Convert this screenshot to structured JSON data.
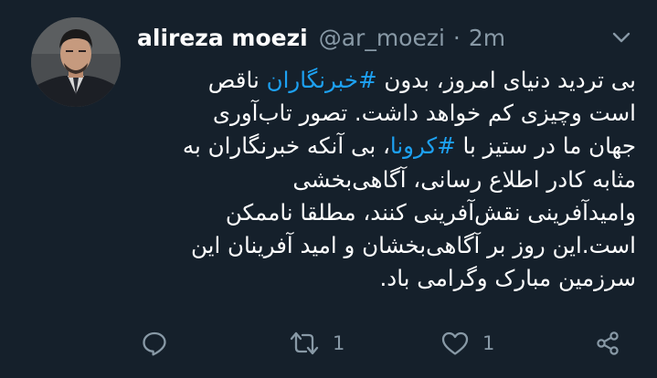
{
  "author": {
    "display_name": "alireza moezi",
    "handle": "@ar_moezi",
    "separator": "·",
    "time": "2m"
  },
  "icons": {
    "avatar": "profile-photo",
    "more": "chevron-down-icon",
    "reply": "reply-icon",
    "retweet": "retweet-icon",
    "like": "heart-icon",
    "share": "share-icon"
  },
  "tweet": {
    "lines": [
      [
        {
          "text": "بی تردید دنیای امروز، بدون ",
          "tag": false
        },
        {
          "text": "#خبرنگاران",
          "tag": true
        },
        {
          "text": " ناقص",
          "tag": false
        }
      ],
      [
        {
          "text": "است وچیزی کم خواهد داشت. تصور تاب‌آوری",
          "tag": false
        }
      ],
      [
        {
          "text": "جهان ما در ستیز با ",
          "tag": false
        },
        {
          "text": "#کرونا",
          "tag": true
        },
        {
          "text": "، بی آنکه خبرنگاران به",
          "tag": false
        }
      ],
      [
        {
          "text": "مثابه کادر اطلاع رسانی، آگاهی‌بخشی",
          "tag": false
        }
      ],
      [
        {
          "text": "وامیدآفرینی نقش‌آفرینی کنند، مطلقا ناممکن",
          "tag": false
        }
      ],
      [
        {
          "text": "است.این روز بر آگاهی‌بخشان و امید آفرینان این",
          "tag": false
        }
      ],
      [
        {
          "text": "سرزمین مبارک وگرامی باد.",
          "tag": false
        }
      ]
    ]
  },
  "actions": {
    "retweet_count": "1",
    "like_count": "1"
  },
  "colors": {
    "background": "#15202b",
    "text": "#ffffff",
    "muted": "#8899a6",
    "link": "#1da1f2"
  }
}
